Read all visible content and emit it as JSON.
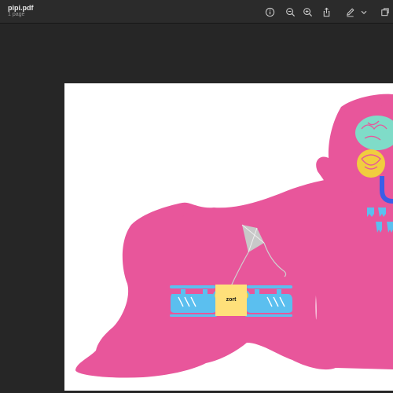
{
  "window": {
    "title": "pipi.pdf",
    "subtitle": "1 page"
  },
  "toolbar": {
    "buttons": [
      {
        "name": "info-button",
        "icon": "info-icon"
      },
      {
        "name": "zoom-out-button",
        "icon": "zoom-out-icon"
      },
      {
        "name": "zoom-in-button",
        "icon": "zoom-in-icon"
      },
      {
        "name": "share-button",
        "icon": "share-icon"
      },
      {
        "name": "markup-button",
        "icon": "pen-icon"
      },
      {
        "name": "markup-menu-button",
        "icon": "chevron-down-icon"
      },
      {
        "name": "rotate-button",
        "icon": "crop-icon"
      }
    ]
  },
  "page": {
    "sticky_note_text": "zort"
  },
  "colors": {
    "background": "#262626",
    "toolbar": "#2b2b2b",
    "baby_pink": "#e8569b",
    "drone_blue": "#5bbfef",
    "brain_teal": "#7fdcc8",
    "sticky_yellow": "#ffe07a",
    "kite_gray": "#c8c8c8",
    "magnet_blue": "#3a5ee8"
  }
}
